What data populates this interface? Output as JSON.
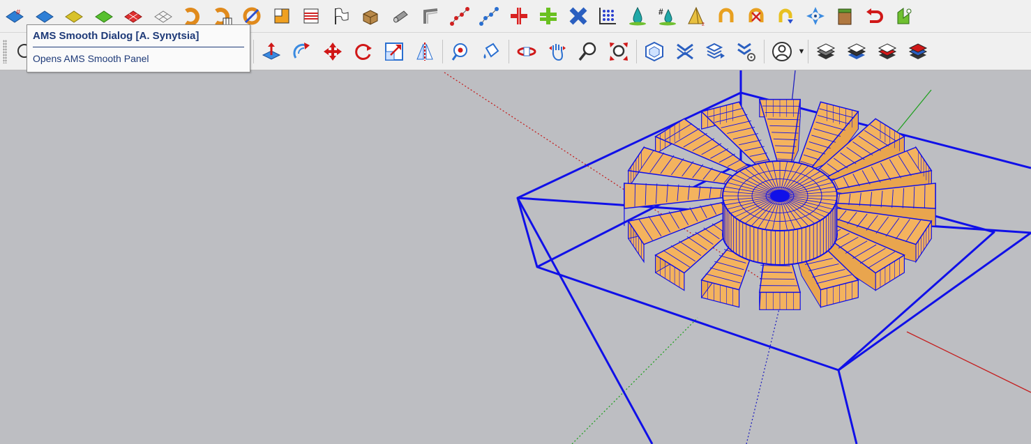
{
  "tooltip": {
    "title": "AMS Smooth Dialog [A. Synytsia]",
    "description": "Opens AMS Smooth Panel"
  },
  "colors": {
    "viewport_bg": "#bdbec2",
    "toolbar_bg": "#f0f0f0",
    "wireframe_blue": "#1010e8",
    "solid_face": "#f4b35e",
    "axis_red": "#c42020",
    "axis_green": "#20a020",
    "axis_blue": "#2020c0"
  },
  "toolbar_row1": [
    "smooth-dialog-icon",
    "smooth-blue-icon",
    "smooth-yellow-icon",
    "smooth-green-icon",
    "smooth-red-icon",
    "smooth-wire-icon",
    "bend-icon",
    "bend-grid-icon",
    "twist-icon",
    "square-icon",
    "lines-icon",
    "flag-icon",
    "box-fold-icon",
    "cylinder-icon",
    "corner-icon",
    "curve-points-icon",
    "curve-points-blue-icon",
    "red-cross-icon",
    "green-cross-icon",
    "diagonal-cross-icon",
    "grid-dots-icon",
    "drop-icon",
    "hash-drop-icon",
    "pyramid-icon",
    "magnet-icon",
    "magnet-cross-icon",
    "cycle-icon",
    "compass-arrows-icon",
    "box-open-icon",
    "undo-icon",
    "green-shape-icon"
  ],
  "toolbar_row2": [
    "search-icon",
    "move-up-icon",
    "rotate-arrow-icon",
    "move-arrows-icon",
    "rotate-icon",
    "scale-icon",
    "mirror-icon",
    "paint-eye-icon",
    "paint-bucket-icon",
    "orbit-icon",
    "pan-icon",
    "zoom-icon",
    "zoom-extents-icon",
    "components-icon",
    "flatten-icon",
    "layers-icon",
    "settings-wave-icon",
    "user-icon",
    "layers-stack-icon",
    "layers-stack-blue-icon",
    "layers-stack-red-icon",
    "layers-stack-color-icon"
  ]
}
